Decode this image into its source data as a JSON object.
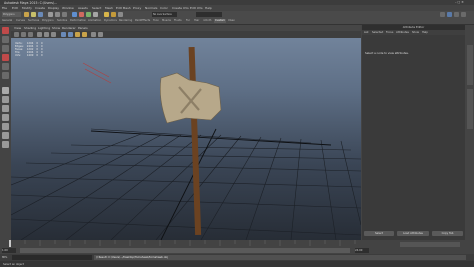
{
  "window": {
    "title": "Autodesk Maya 2015: C:\\Users\\..."
  },
  "menubar": {
    "items": [
      "File",
      "Edit",
      "Modify",
      "Create",
      "Display",
      "Window",
      "Assets",
      "Select",
      "Mesh",
      "Edit Mesh",
      "Proxy",
      "Normals",
      "Color",
      "Create UVs",
      "Edit UVs",
      "Help"
    ],
    "mode": "Polygons",
    "camera_fields": [
      "No Live Surface"
    ]
  },
  "shelf": {
    "tabs": [
      "General",
      "Curves",
      "Surfaces",
      "Polygons",
      "Subdivs",
      "Deformation",
      "Animation",
      "Dynamics",
      "Rendering",
      "PaintEffects",
      "Toon",
      "Muscle",
      "Fluids",
      "Fur",
      "Hair",
      "nCloth",
      "Custom",
      "XGen"
    ],
    "active_tab": "Custom"
  },
  "viewport": {
    "menu": [
      "View",
      "Shading",
      "Lighting",
      "Show",
      "Renderer",
      "Panels"
    ],
    "hud": {
      "rows": [
        {
          "label": "Verts:",
          "v1": "1204",
          "v2": "0",
          "v3": "0"
        },
        {
          "label": "Edges:",
          "v1": "2404",
          "v2": "0",
          "v3": "0"
        },
        {
          "label": "Faces:",
          "v1": "1202",
          "v2": "0",
          "v3": "0"
        },
        {
          "label": "Tris:",
          "v1": "2404",
          "v2": "0",
          "v3": "0"
        },
        {
          "label": "UVs:",
          "v1": "1409",
          "v2": "0",
          "v3": "0"
        }
      ]
    }
  },
  "attribute_editor": {
    "title": "Attribute Editor",
    "menu": [
      "List",
      "Selected",
      "Focus",
      "Attributes",
      "Show",
      "Help"
    ],
    "message": "Select a node to view attributes.",
    "buttons": [
      "Select",
      "Load Attributes",
      "Copy Tab"
    ]
  },
  "timeline": {
    "ticks": [
      "1",
      "2",
      "3",
      "4",
      "5",
      "6",
      "7",
      "8",
      "9",
      "10",
      "11",
      "12",
      "13",
      "14",
      "15",
      "16",
      "17",
      "18",
      "19",
      "20",
      "21",
      "22",
      "23",
      "24"
    ],
    "start": "1.00",
    "end": "24.00"
  },
  "command_line": {
    "label": "MEL",
    "output": "// Result: C:/Users/.../Desktop/Tomahawk/tomahawk.obj"
  },
  "help_line": {
    "text": "Select an object"
  },
  "colors": {
    "viewport_top": "#7688a0",
    "viewport_bottom": "#272d36",
    "grid": "#1a1d22",
    "handle": "#6b4221",
    "blade": "#b7a88a"
  }
}
